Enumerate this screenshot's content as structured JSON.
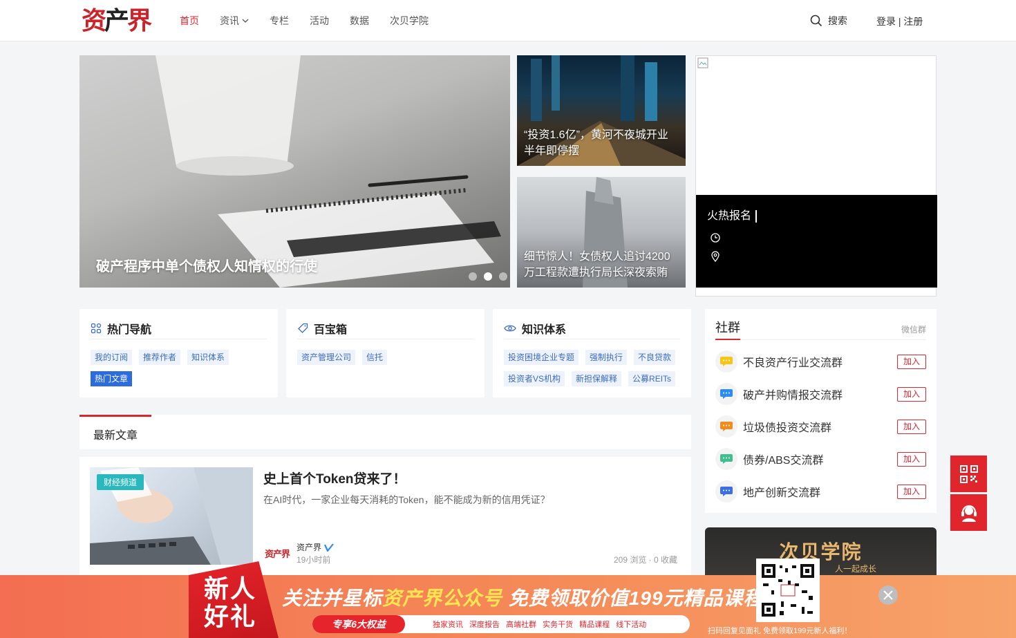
{
  "header": {
    "logo": {
      "c1": "资",
      "c2": "产",
      "c3": "界"
    },
    "nav": [
      {
        "label": "首页",
        "active": true
      },
      {
        "label": "资讯",
        "dropdown": true
      },
      {
        "label": "专栏"
      },
      {
        "label": "活动"
      },
      {
        "label": "数据"
      },
      {
        "label": "次贝学院"
      }
    ],
    "search_label": "搜索",
    "auth_label": "登录 | 注册"
  },
  "hero": {
    "main_title": "破产程序中单个债权人知情权的行使",
    "card1_title": "“投资1.6亿”，黄河不夜城开业半年即停摆",
    "card2_title": "细节惊人！女债权人追讨4200万工程款遭执行局长深夜索贿",
    "slide_count": 3,
    "active_slide": 2
  },
  "event": {
    "title": "火热报名"
  },
  "modules": {
    "hot_nav": {
      "title": "热门导航",
      "tags": [
        "我的订阅",
        "推荐作者",
        "知识体系",
        "热门文章"
      ],
      "active_tag": "热门文章"
    },
    "toolbox": {
      "title": "百宝箱",
      "tags": [
        "资产管理公司",
        "信托"
      ]
    },
    "knowledge": {
      "title": "知识体系",
      "tags": [
        "投资困境企业专题",
        "强制执行",
        "不良贷款",
        "投资者VS机构",
        "新担保解释",
        "公募REITs"
      ]
    }
  },
  "latest": {
    "title": "最新文章"
  },
  "article": {
    "badge": "财经频道",
    "title": "史上首个Token贷来了！",
    "desc": "在AI时代，一家企业每天消耗的Token，能不能成为新的信用凭证？",
    "author_logo": "资产界",
    "author": "资产界",
    "time": "19小时前",
    "stats": "209 浏览 · 0 收藏"
  },
  "community": {
    "title": "社群",
    "subtitle": "微信群",
    "join_label": "加入",
    "groups": [
      {
        "name": "不良资产行业交流群",
        "color": "#f5c518"
      },
      {
        "name": "破产并购情报交流群",
        "color": "#2d8cf0"
      },
      {
        "name": "垃圾债投资交流群",
        "color": "#f08c1e"
      },
      {
        "name": "债券/ABS交流群",
        "color": "#3fbf8e"
      },
      {
        "name": "地产创新交流群",
        "color": "#3b6fe0"
      }
    ]
  },
  "academy": {
    "title": "次贝学院",
    "subtitle": "人一起成长"
  },
  "banner": {
    "gift": "新人好礼",
    "main_a": "关注并星标",
    "main_b": "资产界公众号",
    "main_c": " 免费领取价值199元精品课程！",
    "pill_label": "专享6大权益",
    "pill_items": "独家资讯 深度报告 高端社群 实务干货 精品课程 线下活动",
    "tip": "扫码回复见面礼 免费领取199元新人福利！"
  },
  "colors": {
    "brand_red": "#d8272d",
    "tag_blue": "#3b6bc4",
    "teal": "#29b8bd"
  }
}
